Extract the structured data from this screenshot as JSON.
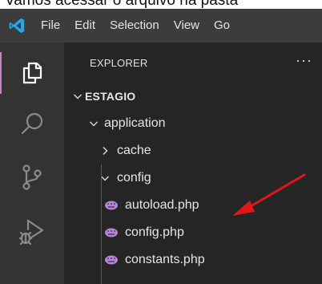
{
  "caption": "Vamos acessar o arquivo na pasta",
  "menubar": {
    "items": [
      "File",
      "Edit",
      "Selection",
      "View",
      "Go"
    ]
  },
  "activitybar": {
    "items": [
      "explorer-icon",
      "search-icon",
      "source-control-icon",
      "run-debug-icon"
    ],
    "active": "explorer-icon"
  },
  "sidebar": {
    "title": "EXPLORER",
    "more": "···",
    "tree": {
      "root": "ESTAGIO",
      "application": "application",
      "cache": "cache",
      "config": "config",
      "files": [
        "autoload.php",
        "config.php",
        "constants.php"
      ]
    }
  },
  "colors": {
    "accent": "#c586c0",
    "php_icon": "#b486d6",
    "arrow": "#e0161b",
    "logo": "#23a9f2"
  }
}
